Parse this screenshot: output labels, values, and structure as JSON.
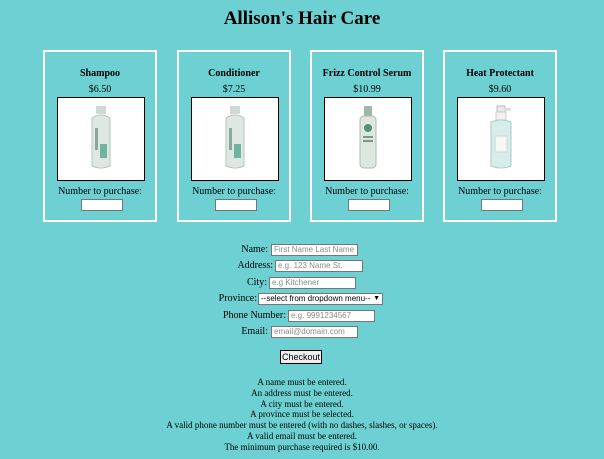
{
  "title": "Allison's Hair Care",
  "quantity_label": "Number to purchase:",
  "products": [
    {
      "name": "Shampoo",
      "price": "$6.50",
      "icon": "shampoo-bottle-icon"
    },
    {
      "name": "Conditioner",
      "price": "$7.25",
      "icon": "conditioner-bottle-icon"
    },
    {
      "name": "Frizz Control Serum",
      "price": "$10.99",
      "icon": "serum-bottle-icon"
    },
    {
      "name": "Heat Protectant",
      "price": "$9.60",
      "icon": "spray-bottle-icon"
    }
  ],
  "form": {
    "name_label": "Name:",
    "name_placeholder": "First Name Last Name",
    "address_label": "Address:",
    "address_placeholder": "e.g. 123 Name St.",
    "city_label": "City:",
    "city_placeholder": "e.g Kitchener",
    "province_label": "Province:",
    "province_selected": "--select from dropdown menu--",
    "phone_label": "Phone Number:",
    "phone_placeholder": "e.g. 9991234567",
    "email_label": "Email:",
    "email_placeholder": "email@domain.com",
    "checkout_label": "Checkout"
  },
  "errors": [
    "A name must be entered.",
    "An address must be entered.",
    "A city must be entered.",
    "A province must be selected.",
    "A valid phone number must be entered (with no dashes, slashes, or spaces).",
    "A valid email must be entered.",
    "The minimum purchase required is $10.00."
  ]
}
